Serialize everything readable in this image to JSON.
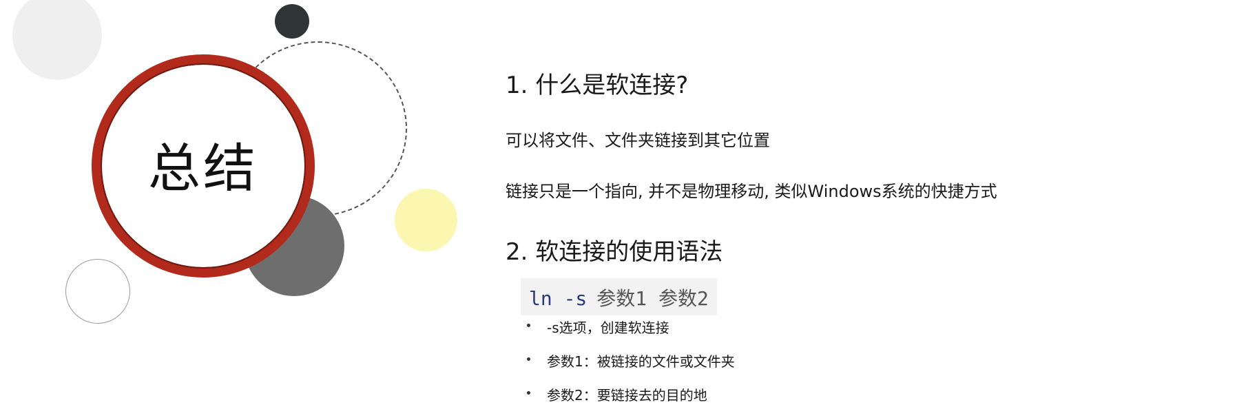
{
  "title_circle": {
    "text": "总结",
    "ring_color": "#b22a1c"
  },
  "sections": [
    {
      "heading": "1. 什么是软连接?",
      "paragraphs": [
        "可以将文件、文件夹链接到其它位置",
        "链接只是一个指向, 并不是物理移动, 类似Windows系统的快捷方式"
      ]
    },
    {
      "heading": "2. 软连接的使用语法",
      "code": {
        "command": "ln -s",
        "args": "参数1 参数2"
      },
      "bullets": [
        "-s选项，创建软连接",
        "参数1：被链接的文件或文件夹",
        "参数2：要链接去的目的地"
      ]
    }
  ],
  "colors": {
    "accent_red": "#b22a1c",
    "accent_yellow": "#fbf6b0",
    "code_background": "#f2f2f2",
    "code_command": "#2a3a7a"
  }
}
